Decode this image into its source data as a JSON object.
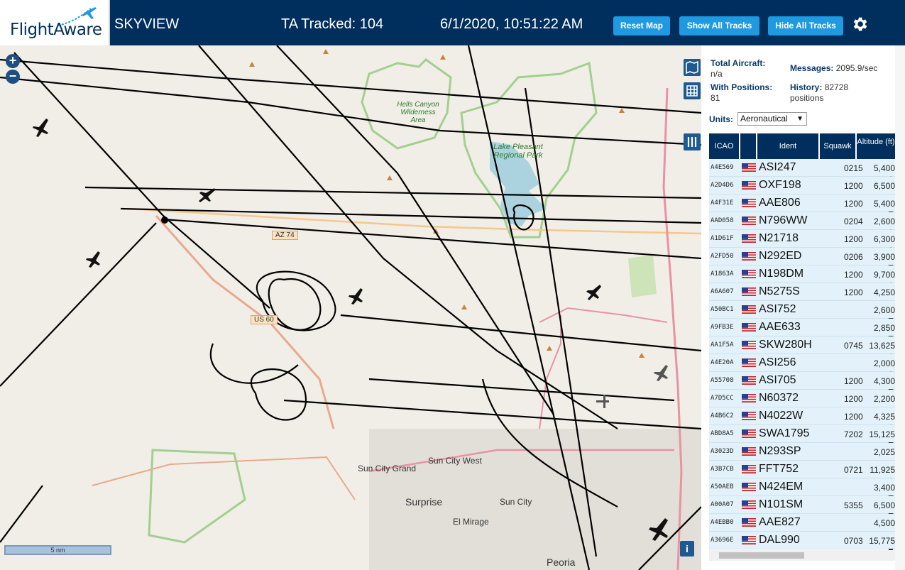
{
  "header": {
    "logo": "FlightAware",
    "app_name": "SKYVIEW",
    "tracked": "TA Tracked: 104",
    "timestamp": "6/1/2020, 10:51:22 AM",
    "buttons": {
      "reset": "Reset Map",
      "show": "Show All Tracks",
      "hide": "Hide All Tracks"
    },
    "settings_icon": "gear-icon"
  },
  "map": {
    "zoom_in": "+",
    "zoom_out": "−",
    "scale_label": "5 nm",
    "info_label": "i",
    "labels": {
      "hells_canyon": "Hells Canyon Wilderness Area",
      "lake_pleasant": "Lake Pleasant Regional Park",
      "az74": "AZ 74",
      "us60": "US 60",
      "sun_city_grand": "Sun City Grand",
      "sun_city_west": "Sun City West",
      "surprise": "Surprise",
      "sun_city": "Sun City",
      "el_mirage": "El Mirage",
      "peoria": "Peoria"
    },
    "colors": {
      "land": "#f1eee8",
      "water": "#aad3df",
      "park": "#cde3b8",
      "highway": "#e892a2",
      "track": "#000000"
    }
  },
  "sidebar": {
    "total_aircraft_label": "Total Aircraft:",
    "total_aircraft_value": "n/a",
    "with_positions_label": "With Positions:",
    "with_positions_value": "81",
    "messages_label": "Messages:",
    "messages_value": "2095.9/sec",
    "history_label": "History:",
    "history_value": "82728 positions",
    "units_label": "Units:",
    "units_value": "Aeronautical",
    "columns": [
      "ICAO",
      "Ident",
      "Squawk",
      "Altitude (ft)"
    ],
    "aircraft": [
      {
        "icao": "A4E569",
        "ident": "ASI247",
        "squawk": "0215",
        "alt": "5,400",
        "trend": "▲"
      },
      {
        "icao": "A2D4D6",
        "ident": "OXF198",
        "squawk": "1200",
        "alt": "6,500",
        "trend": ""
      },
      {
        "icao": "A4F31E",
        "ident": "AAE806",
        "squawk": "1200",
        "alt": "5,400",
        "trend": "▼"
      },
      {
        "icao": "AAD058",
        "ident": "N796WW",
        "squawk": "0204",
        "alt": "2,600",
        "trend": "▲"
      },
      {
        "icao": "A1D61F",
        "ident": "N21718",
        "squawk": "1200",
        "alt": "6,300",
        "trend": "▲"
      },
      {
        "icao": "A2FD50",
        "ident": "N292ED",
        "squawk": "0206",
        "alt": "3,900",
        "trend": "▼"
      },
      {
        "icao": "A1863A",
        "ident": "N198DM",
        "squawk": "1200",
        "alt": "9,700",
        "trend": "▲"
      },
      {
        "icao": "A6A607",
        "ident": "N5275S",
        "squawk": "1200",
        "alt": "4,250",
        "trend": ""
      },
      {
        "icao": "A50BC1",
        "ident": "ASI752",
        "squawk": "",
        "alt": "2,600",
        "trend": "▼"
      },
      {
        "icao": "A9FB3E",
        "ident": "AAE633",
        "squawk": "",
        "alt": "2,850",
        "trend": "▼"
      },
      {
        "icao": "AA1F5A",
        "ident": "SKW280H",
        "squawk": "0745",
        "alt": "13,625",
        "trend": "▲"
      },
      {
        "icao": "A4E20A",
        "ident": "ASI256",
        "squawk": "",
        "alt": "2,000",
        "trend": "▲"
      },
      {
        "icao": "A55708",
        "ident": "ASI705",
        "squawk": "1200",
        "alt": "4,300",
        "trend": "▼"
      },
      {
        "icao": "A7D5CC",
        "ident": "N60372",
        "squawk": "1200",
        "alt": "2,200",
        "trend": ""
      },
      {
        "icao": "A4B6C2",
        "ident": "N4022W",
        "squawk": "1200",
        "alt": "4,325",
        "trend": "▲"
      },
      {
        "icao": "ABD8A5",
        "ident": "SWA1795",
        "squawk": "7202",
        "alt": "15,125",
        "trend": "▼"
      },
      {
        "icao": "A3023D",
        "ident": "N293SP",
        "squawk": "",
        "alt": "2,025",
        "trend": ""
      },
      {
        "icao": "A3B7CB",
        "ident": "FFT752",
        "squawk": "0721",
        "alt": "11,925",
        "trend": "▲"
      },
      {
        "icao": "A50AEB",
        "ident": "N424EM",
        "squawk": "",
        "alt": "3,400",
        "trend": "▼"
      },
      {
        "icao": "A00A07",
        "ident": "N101SM",
        "squawk": "5355",
        "alt": "6,500",
        "trend": "▼"
      },
      {
        "icao": "A4EBB0",
        "ident": "AAE827",
        "squawk": "",
        "alt": "4,500",
        "trend": ""
      },
      {
        "icao": "A3696E",
        "ident": "DAL990",
        "squawk": "0703",
        "alt": "15,775",
        "trend": "▼"
      }
    ]
  }
}
